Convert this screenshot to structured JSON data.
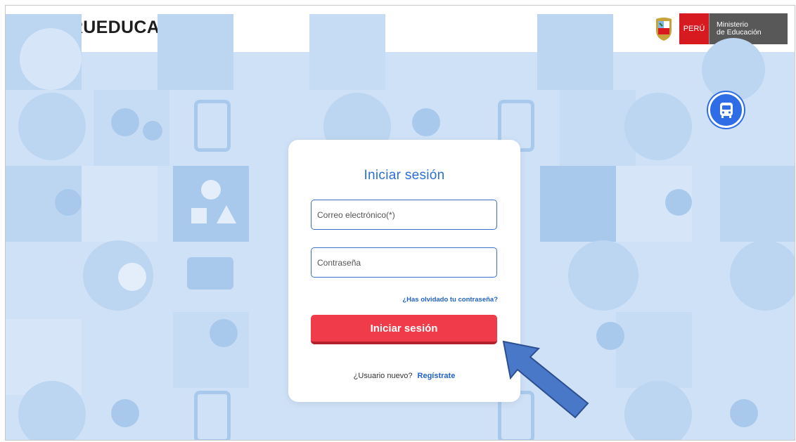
{
  "header": {
    "logo_text": "PERUEDUCA",
    "gov_country": "PERÚ",
    "gov_ministry_line1": "Ministerio",
    "gov_ministry_line2": "de Educación"
  },
  "login": {
    "title": "Iniciar sesión",
    "email_placeholder": "Correo electrónico(*)",
    "password_placeholder": "Contraseña",
    "forgot_link": "¿Has olvidado tu contraseña?",
    "submit_label": "Iniciar sesión",
    "new_user_text": "¿Usuario nuevo?",
    "register_link": "Regístrate"
  },
  "icons": {
    "logo": "peru-map-icon",
    "shield": "national-shield-icon",
    "floating_button": "bus-icon",
    "annotation": "arrow-annotation"
  },
  "colors": {
    "primary_blue": "#2b6fd6",
    "button_red": "#ef3b4a",
    "brand_red": "#e5323b",
    "background_blue": "#cfe1f6"
  }
}
